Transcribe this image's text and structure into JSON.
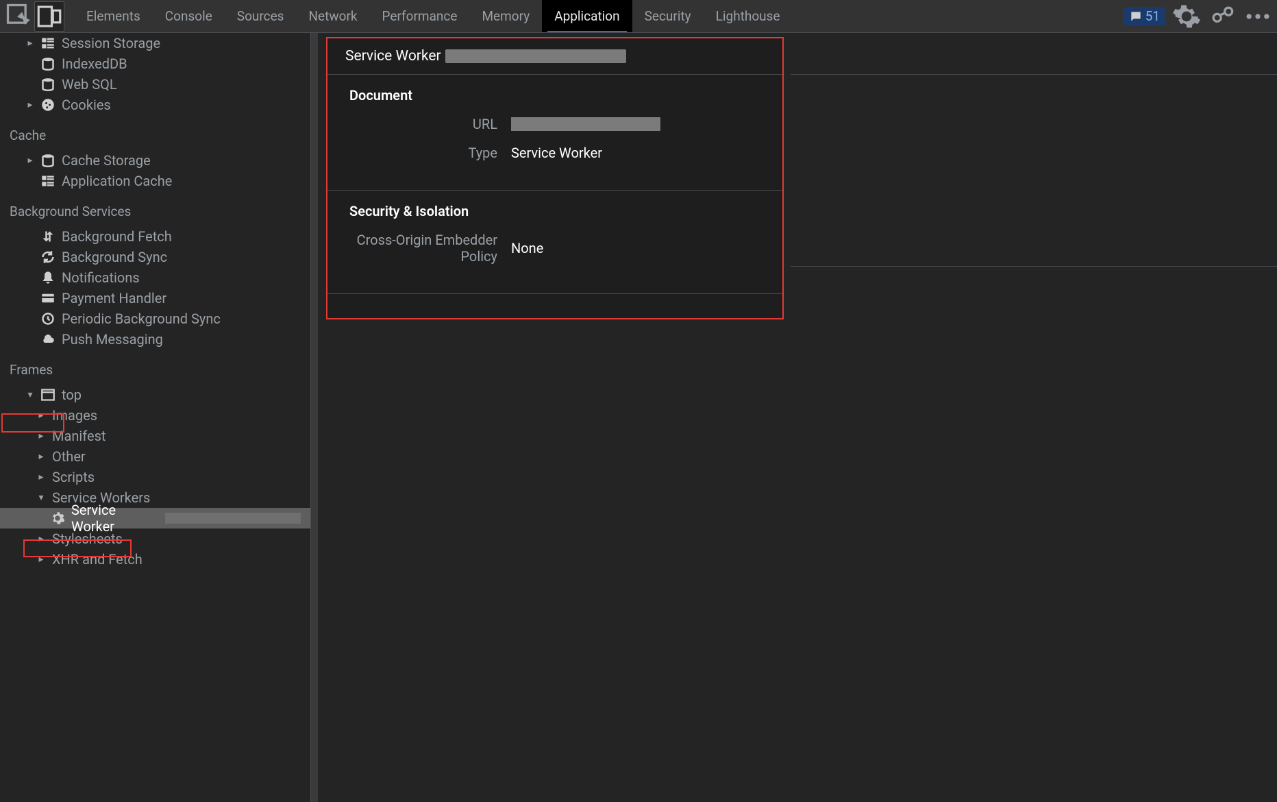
{
  "toolbar": {
    "tabs": {
      "t0": "Elements",
      "t1": "Console",
      "t2": "Sources",
      "t3": "Network",
      "t4": "Performance",
      "t5": "Memory",
      "t6": "Application",
      "t7": "Security",
      "t8": "Lighthouse"
    },
    "error_count": "51"
  },
  "sidebar": {
    "session_storage": "Session Storage",
    "indexeddb": "IndexedDB",
    "websql": "Web SQL",
    "cookies": "Cookies",
    "cache_head": "Cache",
    "cache_storage": "Cache Storage",
    "app_cache": "Application Cache",
    "bg_head": "Background Services",
    "bg_fetch": "Background Fetch",
    "bg_sync": "Background Sync",
    "notifications": "Notifications",
    "payment_handler": "Payment Handler",
    "periodic_bg_sync": "Periodic Background Sync",
    "push_messaging": "Push Messaging",
    "frames_head": "Frames",
    "top": "top",
    "images": "Images",
    "manifest": "Manifest",
    "other": "Other",
    "scripts": "Scripts",
    "service_workers": "Service Workers",
    "selected_sw": "Service Worker",
    "stylesheets": "Stylesheets",
    "xhr_fetch": "XHR and Fetch"
  },
  "panel": {
    "title": "Service Worker",
    "document_section": "Document",
    "url_label": "URL",
    "type_label": "Type",
    "type_value": "Service Worker",
    "security_section": "Security & Isolation",
    "coep_label": "Cross-Origin Embedder Policy",
    "coep_value": "None"
  }
}
